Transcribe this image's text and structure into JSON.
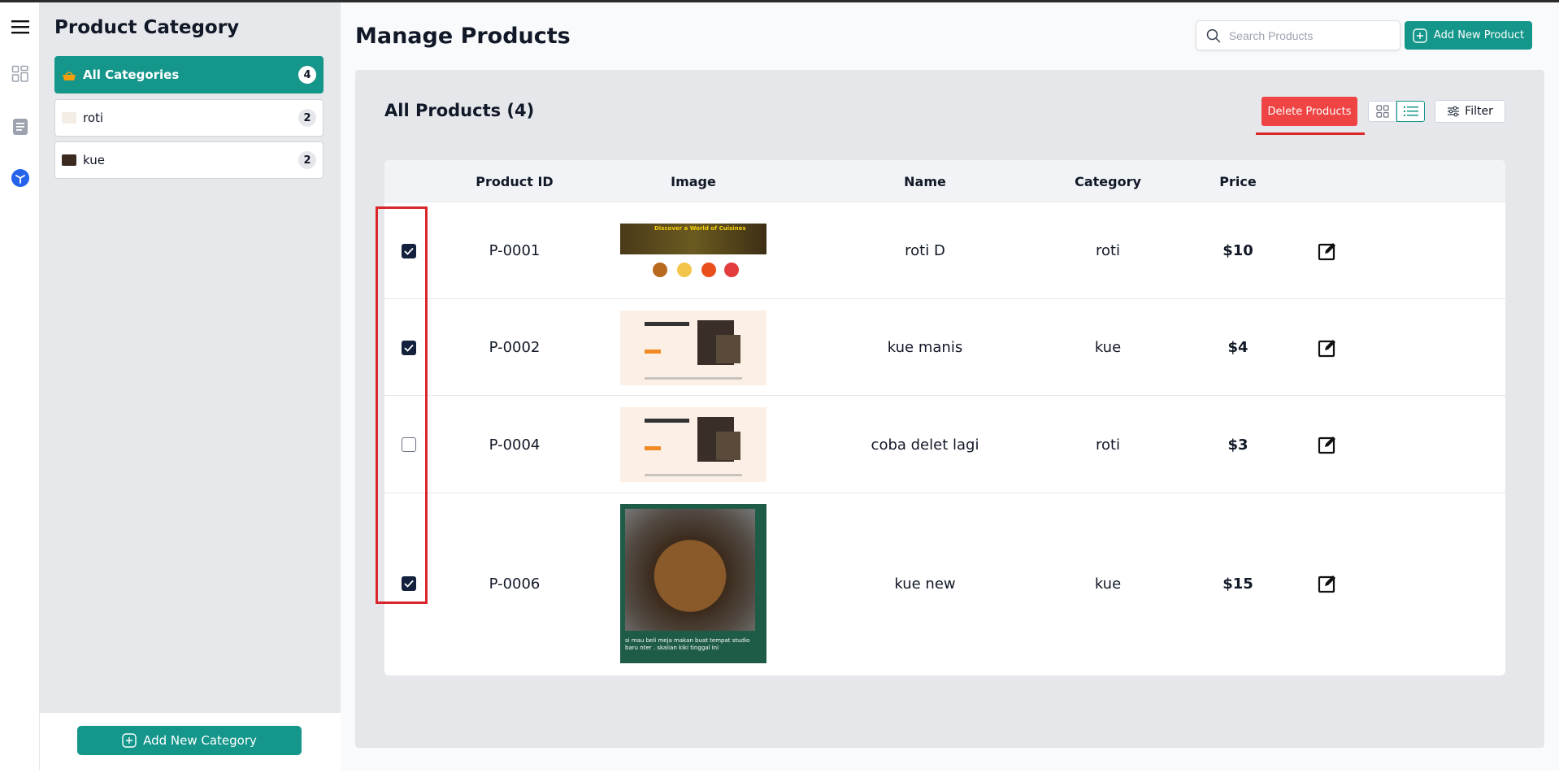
{
  "rail": {
    "icons": [
      "menu-icon",
      "dashboard-icon",
      "document-icon",
      "product-icon"
    ]
  },
  "categories": {
    "title": "Product Category",
    "items": [
      {
        "label": "All Categories",
        "count": "4",
        "active": true
      },
      {
        "label": "roti",
        "count": "2",
        "active": false
      },
      {
        "label": "kue",
        "count": "2",
        "active": false
      }
    ],
    "add_button": "Add New Category"
  },
  "header": {
    "title": "Manage Products",
    "search_placeholder": "Search Products",
    "add_button": "Add New Product"
  },
  "products": {
    "title": "All Products (4)",
    "delete_button": "Delete Products",
    "filter_button": "Filter",
    "view_mode": "list",
    "columns": [
      "Product ID",
      "Image",
      "Name",
      "Category",
      "Price"
    ],
    "rows": [
      {
        "id": "P-0001",
        "name": "roti D",
        "category": "roti",
        "price": "$10",
        "checked": true,
        "image": "food-landing"
      },
      {
        "id": "P-0002",
        "name": "kue manis",
        "category": "kue",
        "price": "$4",
        "checked": true,
        "image": "meal-landing"
      },
      {
        "id": "P-0004",
        "name": "coba delet lagi",
        "category": "roti",
        "price": "$3",
        "checked": false,
        "image": "meal-landing"
      },
      {
        "id": "P-0006",
        "name": "kue new",
        "category": "kue",
        "price": "$15",
        "checked": true,
        "image": "wooden-table-photo"
      }
    ]
  },
  "thumb_text": {
    "food_banner": "Discover a World of Cuisines",
    "table_caption": "si mau beli meja makan buat tempat studio baru nter . skalian kiki tinggal ini"
  },
  "colors": {
    "accent": "#14968a",
    "danger": "#ef4444",
    "checkbox": "#14213d",
    "highlight": "#d9262b"
  }
}
